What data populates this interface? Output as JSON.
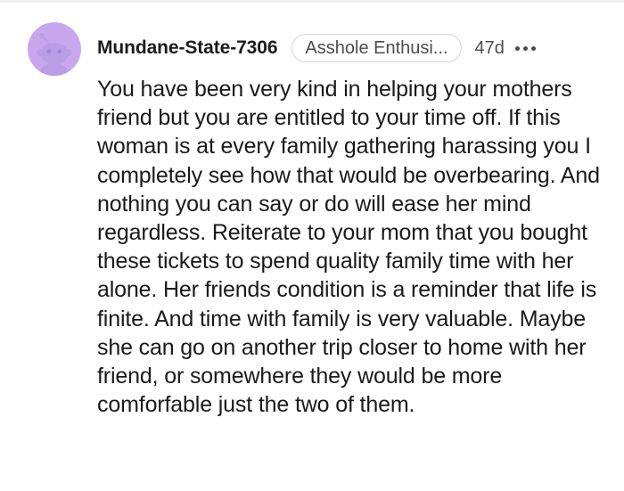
{
  "comment": {
    "username": "Mundane-State-7306",
    "flair": "Asshole Enthusi...",
    "age": "47d",
    "avatar_icon": "reddit-snoo-avatar-icon",
    "avatar_color": "#c9a7ef",
    "more_icon": "more-options-icon",
    "body": "You have been very kind in helping your mothers friend but you are entitled to your time off. If this woman is at every family gathering harassing you I completely see how that would be overbearing. And nothing you can say or do will ease her mind regardless. Reiterate to your mom that you bought these tickets to spend quality family time with her alone. Her friends condition is a reminder that life is finite. And time with family is very valuable. Maybe she can go on another trip closer to home with her friend, or somewhere they would be more comforfable just the two of them."
  }
}
